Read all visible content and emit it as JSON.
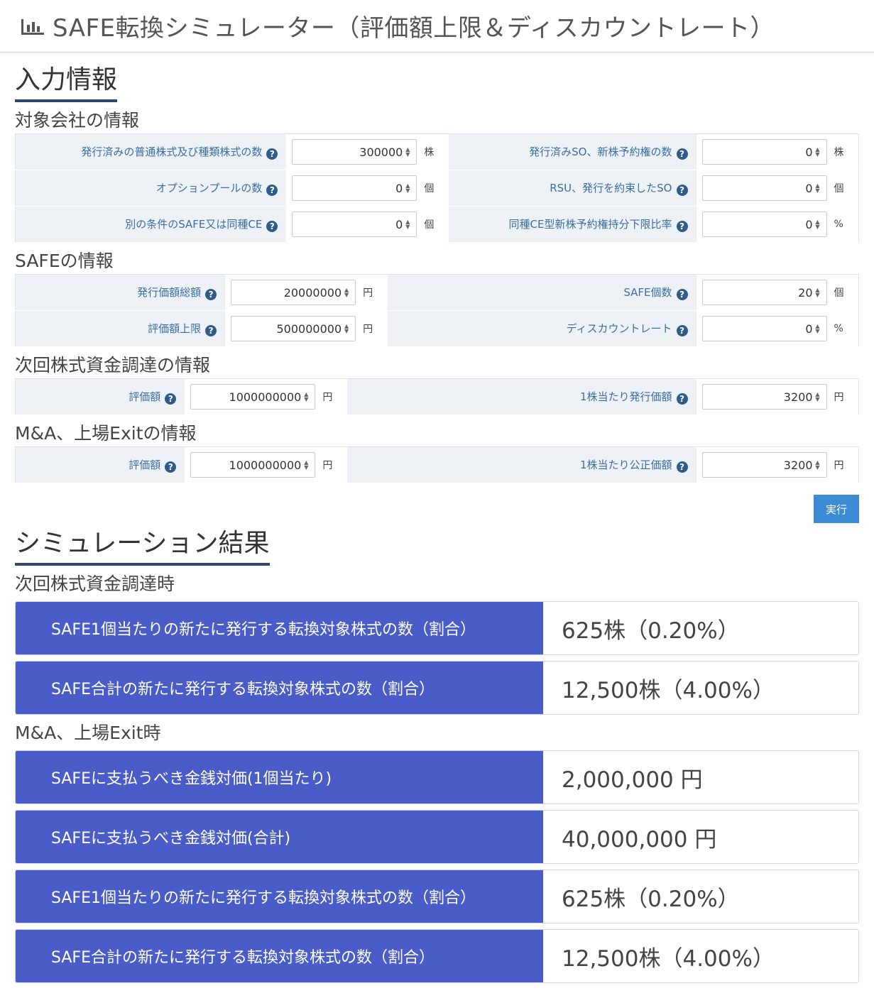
{
  "header": {
    "title": "SAFE転換シミュレーター（評価額上限＆ディスカウントレート）",
    "icon": "bar-chart-icon"
  },
  "input_section": {
    "title": "入力情報",
    "company": {
      "title": "対象会社の情報",
      "rows": [
        {
          "left": {
            "label": "発行済みの普通株式及び種類株式の数",
            "value": "300000",
            "unit": "株"
          },
          "right": {
            "label": "発行済みSO、新株予約権の数",
            "value": "0",
            "unit": "株"
          }
        },
        {
          "left": {
            "label": "オプションプールの数",
            "value": "0",
            "unit": "個"
          },
          "right": {
            "label": "RSU、発行を約束したSO",
            "value": "0",
            "unit": "個"
          }
        },
        {
          "left": {
            "label": "別の条件のSAFE又は同種CE",
            "value": "0",
            "unit": "個"
          },
          "right": {
            "label": "同種CE型新株予約権持分下限比率",
            "value": "0",
            "unit": "%"
          }
        }
      ]
    },
    "safe": {
      "title": "SAFEの情報",
      "rows": [
        {
          "left": {
            "label": "発行価額総額",
            "value": "20000000",
            "unit": "円"
          },
          "right": {
            "label": "SAFE個数",
            "value": "20",
            "unit": "個"
          }
        },
        {
          "left": {
            "label": "評価額上限",
            "value": "500000000",
            "unit": "円"
          },
          "right": {
            "label": "ディスカウントレート",
            "value": "0",
            "unit": "%"
          }
        }
      ]
    },
    "next_round": {
      "title": "次回株式資金調達の情報",
      "rows": [
        {
          "left": {
            "label": "評価額",
            "value": "1000000000",
            "unit": "円"
          },
          "right": {
            "label": "1株当たり発行価額",
            "value": "3200",
            "unit": "円"
          }
        }
      ]
    },
    "exit": {
      "title": "M&A、上場Exitの情報",
      "rows": [
        {
          "left": {
            "label": "評価額",
            "value": "1000000000",
            "unit": "円"
          },
          "right": {
            "label": "1株当たり公正価額",
            "value": "3200",
            "unit": "円"
          }
        }
      ]
    },
    "run_label": "実行"
  },
  "results": {
    "title": "シミュレーション結果",
    "next_round": {
      "title": "次回株式資金調達時",
      "rows": [
        {
          "label": "SAFE1個当たりの新たに発行する転換対象株式の数（割合）",
          "value": "625株（0.20%）"
        },
        {
          "label": "SAFE合計の新たに発行する転換対象株式の数（割合）",
          "value": "12,500株（4.00%）"
        }
      ]
    },
    "exit": {
      "title": "M&A、上場Exit時",
      "rows": [
        {
          "label": "SAFEに支払うべき金銭対価(1個当たり)",
          "value": "2,000,000 円"
        },
        {
          "label": "SAFEに支払うべき金銭対価(合計)",
          "value": "40,000,000 円"
        },
        {
          "label": "SAFE1個当たりの新たに発行する転換対象株式の数（割合）",
          "value": "625株（0.20%）"
        },
        {
          "label": "SAFE合計の新たに発行する転換対象株式の数（割合）",
          "value": "12,500株（4.00%）"
        }
      ]
    }
  }
}
